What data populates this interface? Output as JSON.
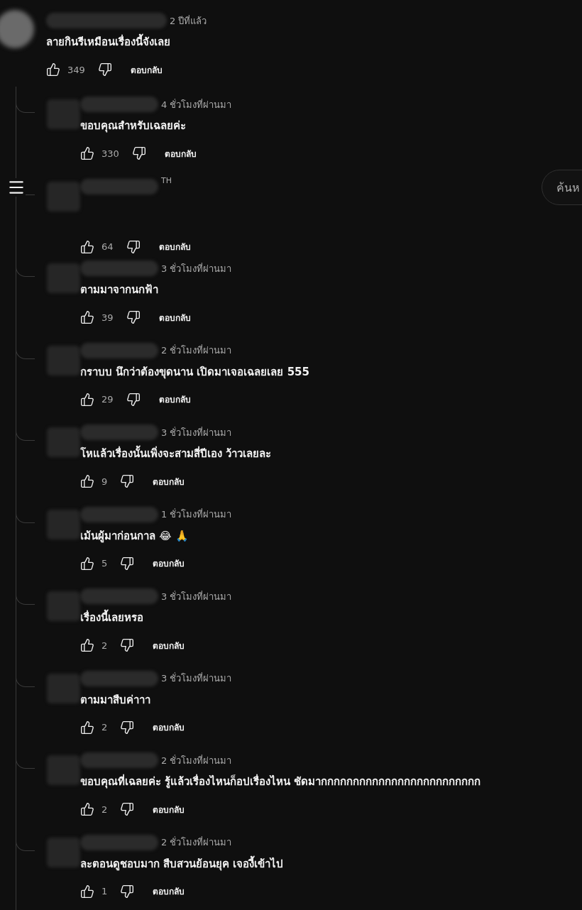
{
  "header": {
    "search": {
      "placeholder": "ค้นห"
    }
  },
  "comment": {
    "meta": "2 ปีที่แล้ว",
    "text": "ลายกินรีเหมือนเรื่องนี้จังเลย",
    "likes": "349",
    "reply_label": "ตอบกลับ"
  },
  "replies": [
    {
      "meta": "4 ชั่วโมงที่ผ่านมา",
      "text": "ขอบคุณสำหรับเฉลยค่ะ",
      "likes": "330",
      "reply_label": "ตอบกลับ"
    },
    {
      "meta": "TH",
      "likes": "64",
      "reply_label": "ตอบกลับ"
    },
    {
      "meta": "3 ชั่วโมงที่ผ่านมา",
      "text": "ตามมาจากนกฟ้า",
      "likes": "39",
      "reply_label": "ตอบกลับ"
    },
    {
      "meta": "2 ชั่วโมงที่ผ่านมา",
      "text": "กราบบ นึกว่าต้องขุดนาน เปิดมาเจอเฉลยเลย 555",
      "likes": "29",
      "reply_label": "ตอบกลับ"
    },
    {
      "meta": "3 ชั่วโมงที่ผ่านมา",
      "text": "โหแล้วเรื่องนั้นเพิ่งจะสามสี่ปีเอง ว้าวเลยละ",
      "likes": "9",
      "reply_label": "ตอบกลับ"
    },
    {
      "meta": "1 ชั่วโมงที่ผ่านมา",
      "text": "เม้นผู้มาก่อนกาล 😂 🙏",
      "likes": "5",
      "reply_label": "ตอบกลับ"
    },
    {
      "meta": "3 ชั่วโมงที่ผ่านมา",
      "text": "เรื่องนี้เลยหรอ",
      "likes": "2",
      "reply_label": "ตอบกลับ"
    },
    {
      "meta": "3 ชั่วโมงที่ผ่านมา",
      "text": "ตามมาสืบค่าาา",
      "likes": "2",
      "reply_label": "ตอบกลับ"
    },
    {
      "meta": "2 ชั่วโมงที่ผ่านมา",
      "text": "ขอบคุณที่เฉลยค่ะ รู้แล้วเรื่องไหนก็อปเรื่องไหน ชัดมากกกกกกกกกกกกกกกกกกกกกกกกก",
      "likes": "2",
      "reply_label": "ตอบกลับ"
    },
    {
      "meta": "2 ชั่วโมงที่ผ่านมา",
      "text": "ละตอนดูชอบมาก สืบสวนย้อนยุค เจองี้เข้าไป",
      "likes": "1",
      "reply_label": "ตอบกลับ"
    }
  ]
}
